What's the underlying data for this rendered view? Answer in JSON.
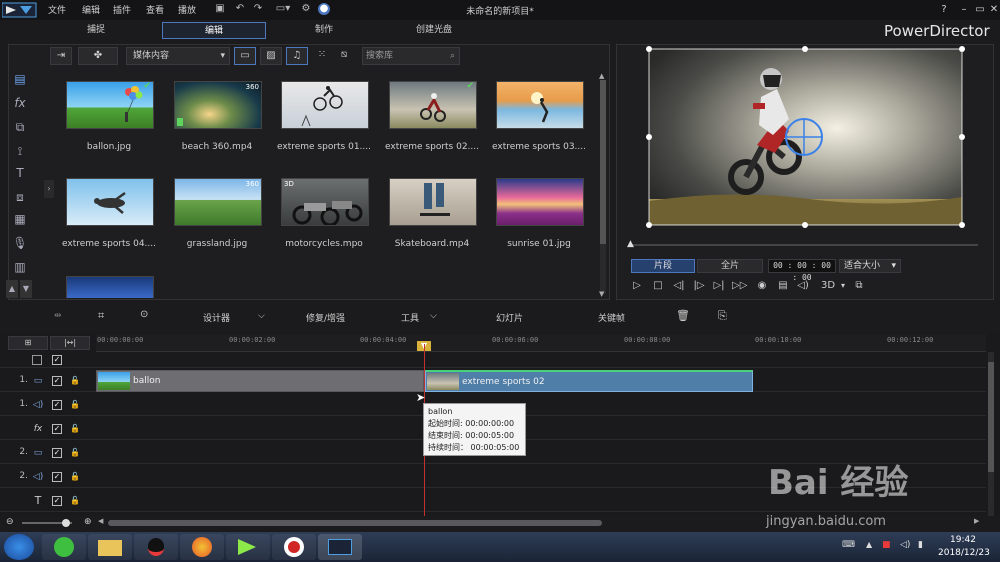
{
  "window": {
    "title": "未命名的新项目*"
  },
  "menu": [
    "文件",
    "编辑",
    "插件",
    "查看",
    "播放"
  ],
  "mode_tabs": [
    {
      "label": "捕捉",
      "active": false
    },
    {
      "label": "编辑",
      "active": true
    },
    {
      "label": "制作",
      "active": false
    },
    {
      "label": "创建光盘",
      "active": false
    }
  ],
  "brand": "PowerDirector",
  "library": {
    "media_filter": "媒体内容",
    "search_placeholder": "搜索库",
    "items": [
      {
        "label": "ballon.jpg",
        "badge": "",
        "checked": true
      },
      {
        "label": "beach 360.mp4",
        "badge": "360",
        "checked": false
      },
      {
        "label": "extreme sports 01....",
        "badge": "",
        "checked": false
      },
      {
        "label": "extreme sports 02....",
        "badge": "",
        "checked": true
      },
      {
        "label": "extreme sports 03....",
        "badge": "",
        "checked": false
      },
      {
        "label": "extreme sports 04....",
        "badge": "",
        "checked": false
      },
      {
        "label": "grassland.jpg",
        "badge": "360",
        "checked": false
      },
      {
        "label": "motorcycles.mpo",
        "badge": "3D",
        "checked": false
      },
      {
        "label": "Skateboard.mp4",
        "badge": "",
        "checked": false
      },
      {
        "label": "sunrise 01.jpg",
        "badge": "",
        "checked": false
      }
    ]
  },
  "preview": {
    "segment_label": "片段",
    "full_label": "全片",
    "timecode": "00 : 00 : 00 : 00",
    "fit_label": "适合大小",
    "mode_3d": "3D"
  },
  "edit_toolbar": {
    "designer": "设计器",
    "fix": "修复/增强",
    "tools": "工具",
    "slideshow": "幻灯片",
    "keyframe": "关键帧"
  },
  "timeline": {
    "ticks": [
      "00:00:00:00",
      "00:00:02:00",
      "00:00:04:00",
      "00:00:06:00",
      "00:00:08:00",
      "00:00:10:00",
      "00:00:12:00"
    ],
    "tracks": [
      {
        "num": "",
        "icon": "□"
      },
      {
        "num": "1.",
        "icon": "▭"
      },
      {
        "num": "1.",
        "icon": "◁)"
      },
      {
        "num": "",
        "icon": "fx"
      },
      {
        "num": "2.",
        "icon": "▭"
      },
      {
        "num": "2.",
        "icon": "◁)"
      },
      {
        "num": "",
        "icon": "T"
      }
    ],
    "clips": [
      {
        "label": "ballon"
      },
      {
        "label": "extreme sports 02"
      }
    ],
    "tooltip": {
      "name": "ballon",
      "start": "起始时间:  00:00:00:00",
      "end": "结束时间:  00:00:05:00",
      "duration": "持续时间：  00:00:05:00"
    }
  },
  "taskbar": {
    "time": "19:42",
    "date": "2018/12/23"
  },
  "watermark": {
    "text": "Bai 经验",
    "url": "jingyan.baidu.com"
  }
}
